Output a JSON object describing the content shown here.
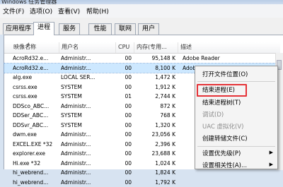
{
  "window": {
    "title": "Windows 任务管理器"
  },
  "menu": [
    "文件(F)",
    "选项(O)",
    "查看(V)",
    "帮助(H)"
  ],
  "tabs": [
    "应用程序",
    "进程",
    "服务",
    "性能",
    "联网",
    "用户"
  ],
  "columns": [
    "映像名称",
    "用户名",
    "CPU",
    "内存(专用...",
    "描述"
  ],
  "rows": [
    {
      "name": "AcroRd32.e...",
      "user": "Administr...",
      "cpu": "00",
      "mem": "95,148 K",
      "desc": "Adobe Reader"
    },
    {
      "name": "AcroRd32.e...",
      "user": "Administr...",
      "cpu": "00",
      "mem": "8,100 K",
      "desc": "Adobe Reader"
    },
    {
      "name": "alg.exe",
      "user": "LOCAL SER...",
      "cpu": "00",
      "mem": "1,472 K",
      "desc": ""
    },
    {
      "name": "csrss.exe",
      "user": "SYSTEM",
      "cpu": "00",
      "mem": "1,912 K",
      "desc": ""
    },
    {
      "name": "csrss.exe",
      "user": "SYSTEM",
      "cpu": "01",
      "mem": "2,744 K",
      "desc": ""
    },
    {
      "name": "DDSco_ABC...",
      "user": "Administr...",
      "cpu": "00",
      "mem": "872 K",
      "desc": ""
    },
    {
      "name": "DDSer_ABC...",
      "user": "SYSTEM",
      "cpu": "00",
      "mem": "768 K",
      "desc": ""
    },
    {
      "name": "DDSvr_ABC...",
      "user": "SYSTEM",
      "cpu": "00",
      "mem": "1,320 K",
      "desc": ""
    },
    {
      "name": "dwm.exe",
      "user": "Administr...",
      "cpu": "00",
      "mem": "23,056 K",
      "desc": ""
    },
    {
      "name": "EXCEL.EXE *32",
      "user": "Administr...",
      "cpu": "00",
      "mem": "2,396 K",
      "desc": ""
    },
    {
      "name": "explorer.exe",
      "user": "Administr...",
      "cpu": "00",
      "mem": "23,688 K",
      "desc": ""
    },
    {
      "name": "Hi.exe *32",
      "user": "Administr...",
      "cpu": "00",
      "mem": "1,024 K",
      "desc": ""
    },
    {
      "name": "hi_webrend...",
      "user": "Administr...",
      "cpu": "00",
      "mem": "1,824 K",
      "desc": ""
    },
    {
      "name": "hi_webrend...",
      "user": "Administr...",
      "cpu": "00",
      "mem": "1,792 K",
      "desc": ""
    }
  ],
  "context_menu": {
    "items": [
      {
        "label": "打开文件位置(O)",
        "disabled": false
      },
      {
        "label": "结束进程(E)",
        "disabled": false
      },
      {
        "label": "结束进程树(T)",
        "disabled": false
      },
      {
        "label": "调试(D)",
        "disabled": true
      },
      {
        "label": "UAC 虚拟化(V)",
        "disabled": true
      },
      {
        "label": "创建转储文件(C)",
        "disabled": false
      },
      {
        "label": "设置优先级(P)",
        "disabled": false
      },
      {
        "label": "设置相关性(A)...",
        "disabled": false
      }
    ],
    "submenu_arrow": "▶"
  },
  "highlight_color": "#e53237"
}
